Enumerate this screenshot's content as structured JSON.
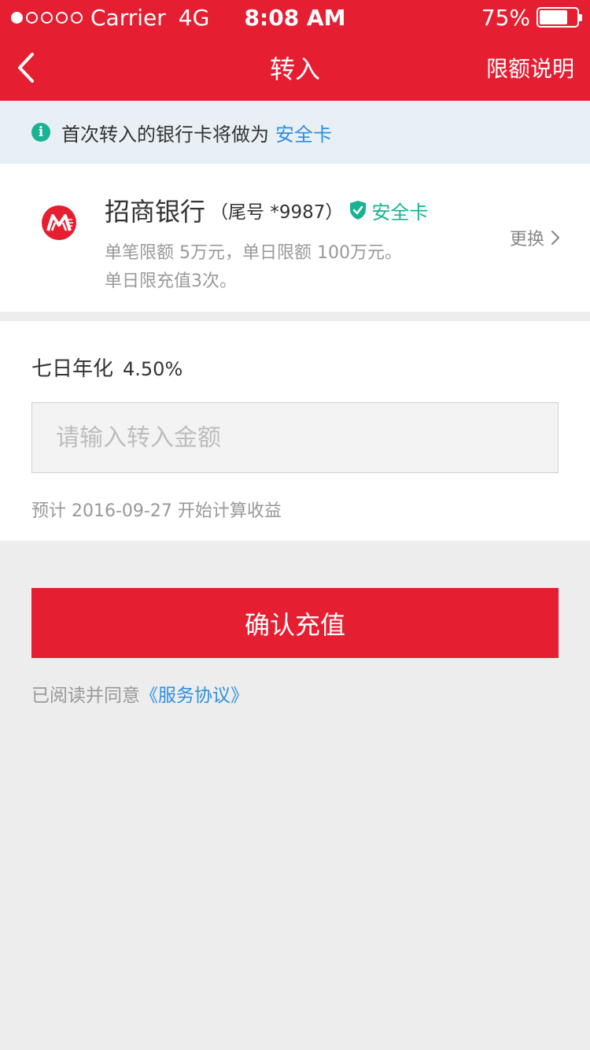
{
  "status_bar": {
    "signal_bars": 1,
    "signal_total": 5,
    "carrier": "Carrier",
    "network": "4G",
    "time": "8:08 AM",
    "battery": "75%",
    "battery_level": 0.75
  },
  "nav": {
    "title": "转入",
    "right_label": "限额说明",
    "back_icon": "chevron-left-icon"
  },
  "notice": {
    "icon": "info-icon",
    "text": "首次转入的银行卡将做为",
    "highlight": "安全卡"
  },
  "bank": {
    "logo_icon": "cmb-logo-icon",
    "name": "招商银行",
    "tail": "（尾号 *9987）",
    "badge_icon": "shield-check-icon",
    "badge_label": "安全卡",
    "limit_line1": "单笔限额 5万元，单日限额 100万元。",
    "limit_line2": "单日限充值3次。",
    "change_label": "更换"
  },
  "amount": {
    "yield_label": "七日年化",
    "yield_value": "4.50%",
    "input_placeholder": "请输入转入金额",
    "input_value": "",
    "estimate": "预计 2016-09-27 开始计算收益"
  },
  "actions": {
    "confirm_label": "确认充值",
    "agreement_prefix": "已阅读并同意",
    "agreement_link": "《服务协议》"
  },
  "colors": {
    "brand_red": "#e61e32",
    "accent_green": "#19b394",
    "link_blue": "#2f8fe0"
  }
}
